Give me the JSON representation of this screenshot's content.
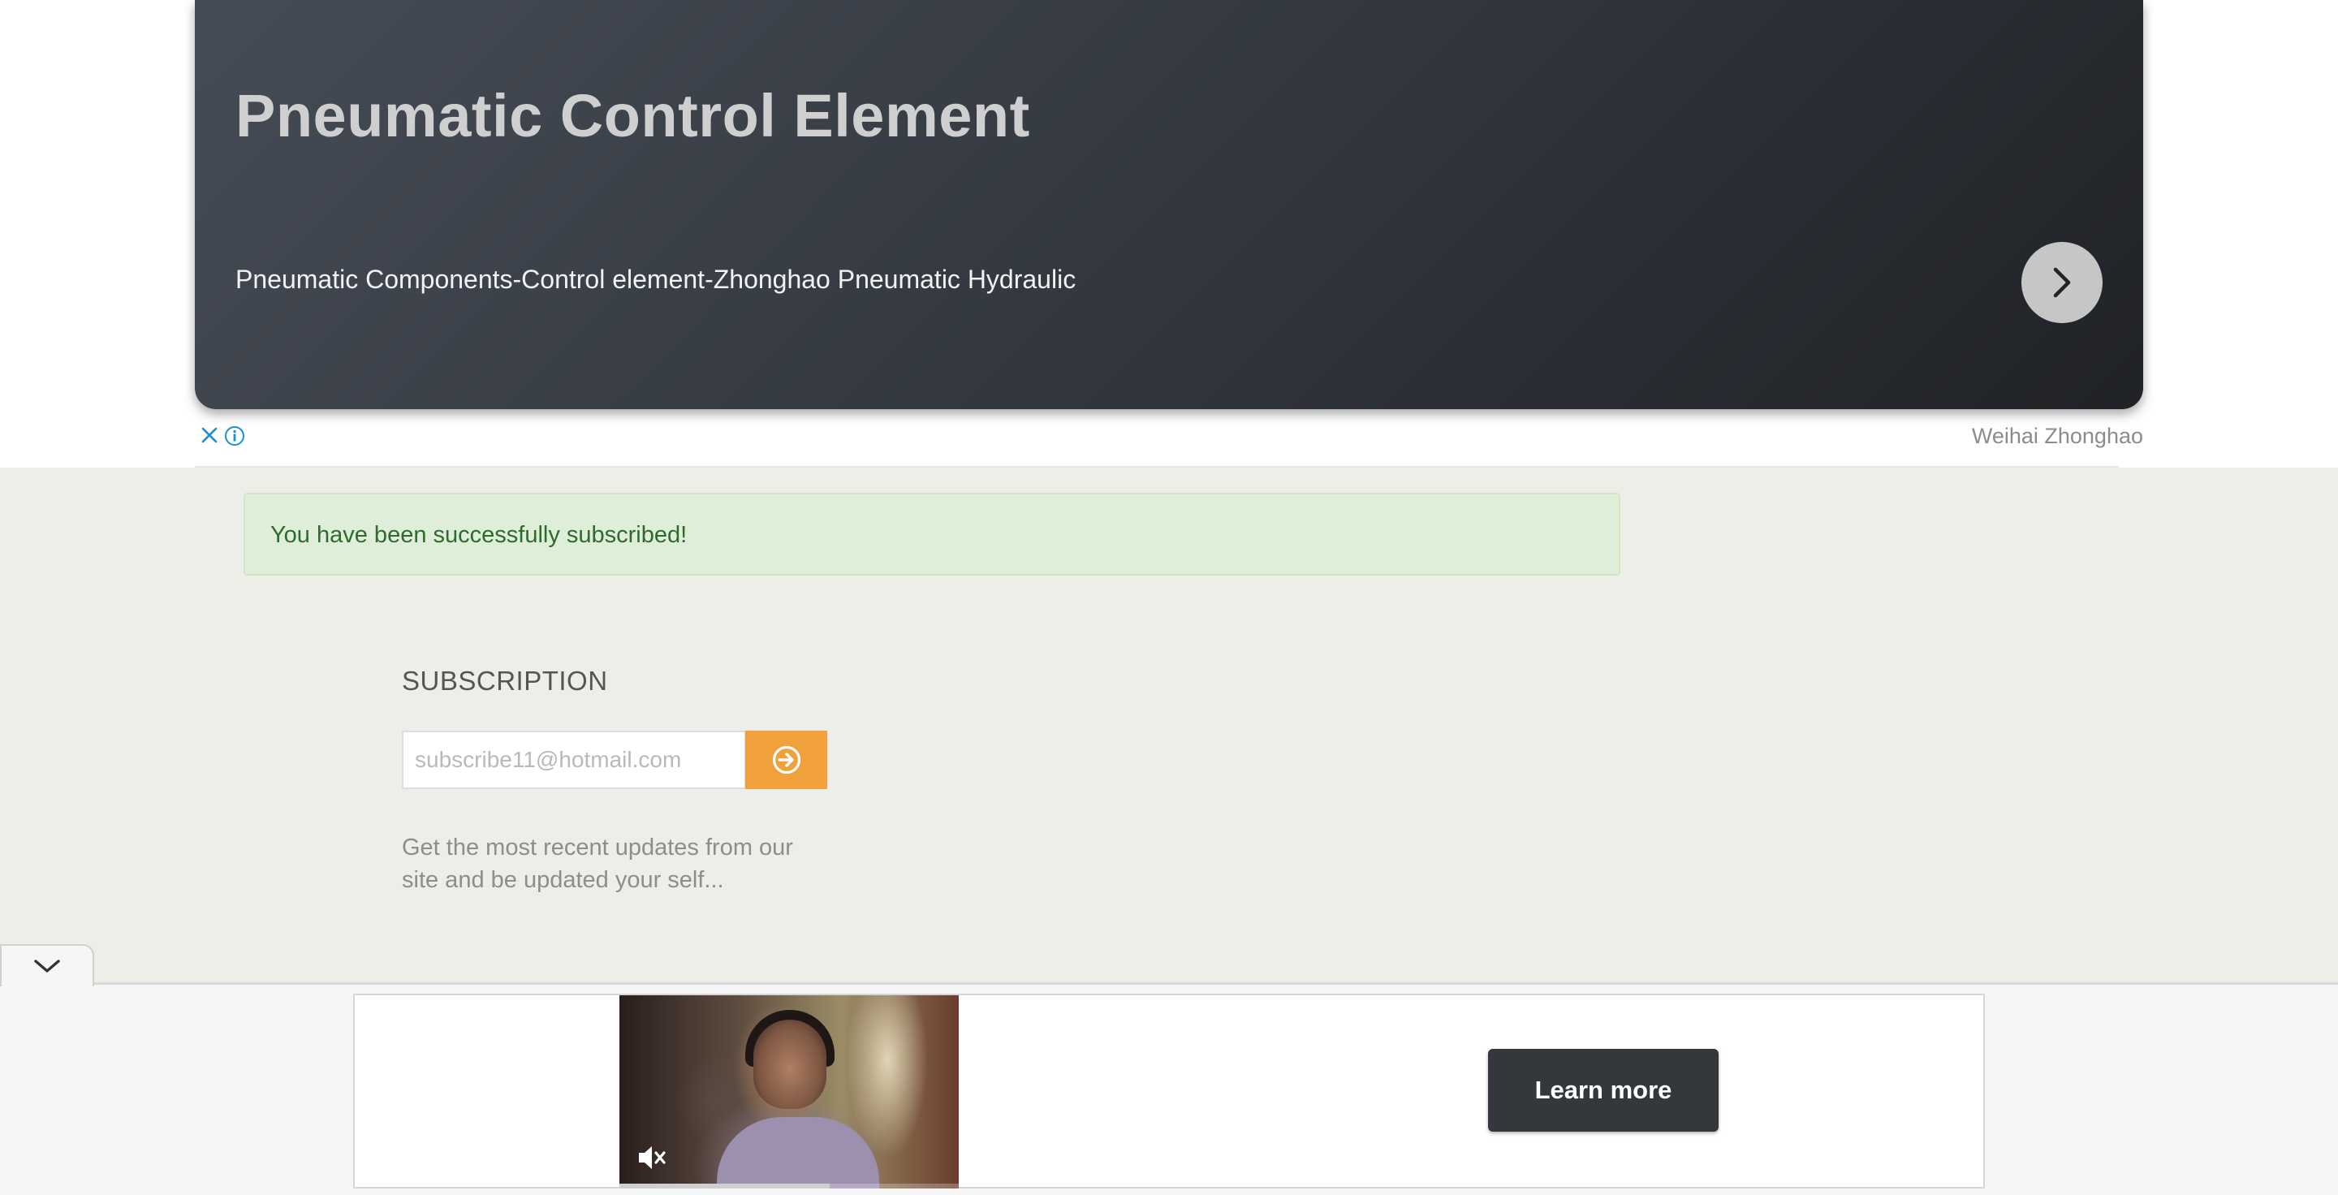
{
  "top_ad": {
    "title": "Pneumatic Control Element",
    "subtitle": "Pneumatic Components-Control element-Zhonghao Pneumatic Hydraulic",
    "sponsor": "Weihai Zhonghao",
    "next_icon": "chevron-right-icon",
    "close_icon": "close-icon",
    "info_icon": "info-icon"
  },
  "alert": {
    "message": "You have been successfully subscribed!"
  },
  "subscription": {
    "heading": "SUBSCRIPTION",
    "email_placeholder": "subscribe11@hotmail.com",
    "submit_icon": "arrow-circle-right-icon",
    "description": "Get the most recent updates from our site and be updated your self..."
  },
  "bottom_ad": {
    "collapse_icon": "chevron-down-icon",
    "mute_icon": "muted-speaker-icon",
    "video_progress": 0.62,
    "cta_label": "Learn more"
  },
  "colors": {
    "alert_bg": "#dfeed8",
    "alert_text": "#2f6a2f",
    "accent": "#f0a13c",
    "page_bg": "#eeeee8"
  }
}
